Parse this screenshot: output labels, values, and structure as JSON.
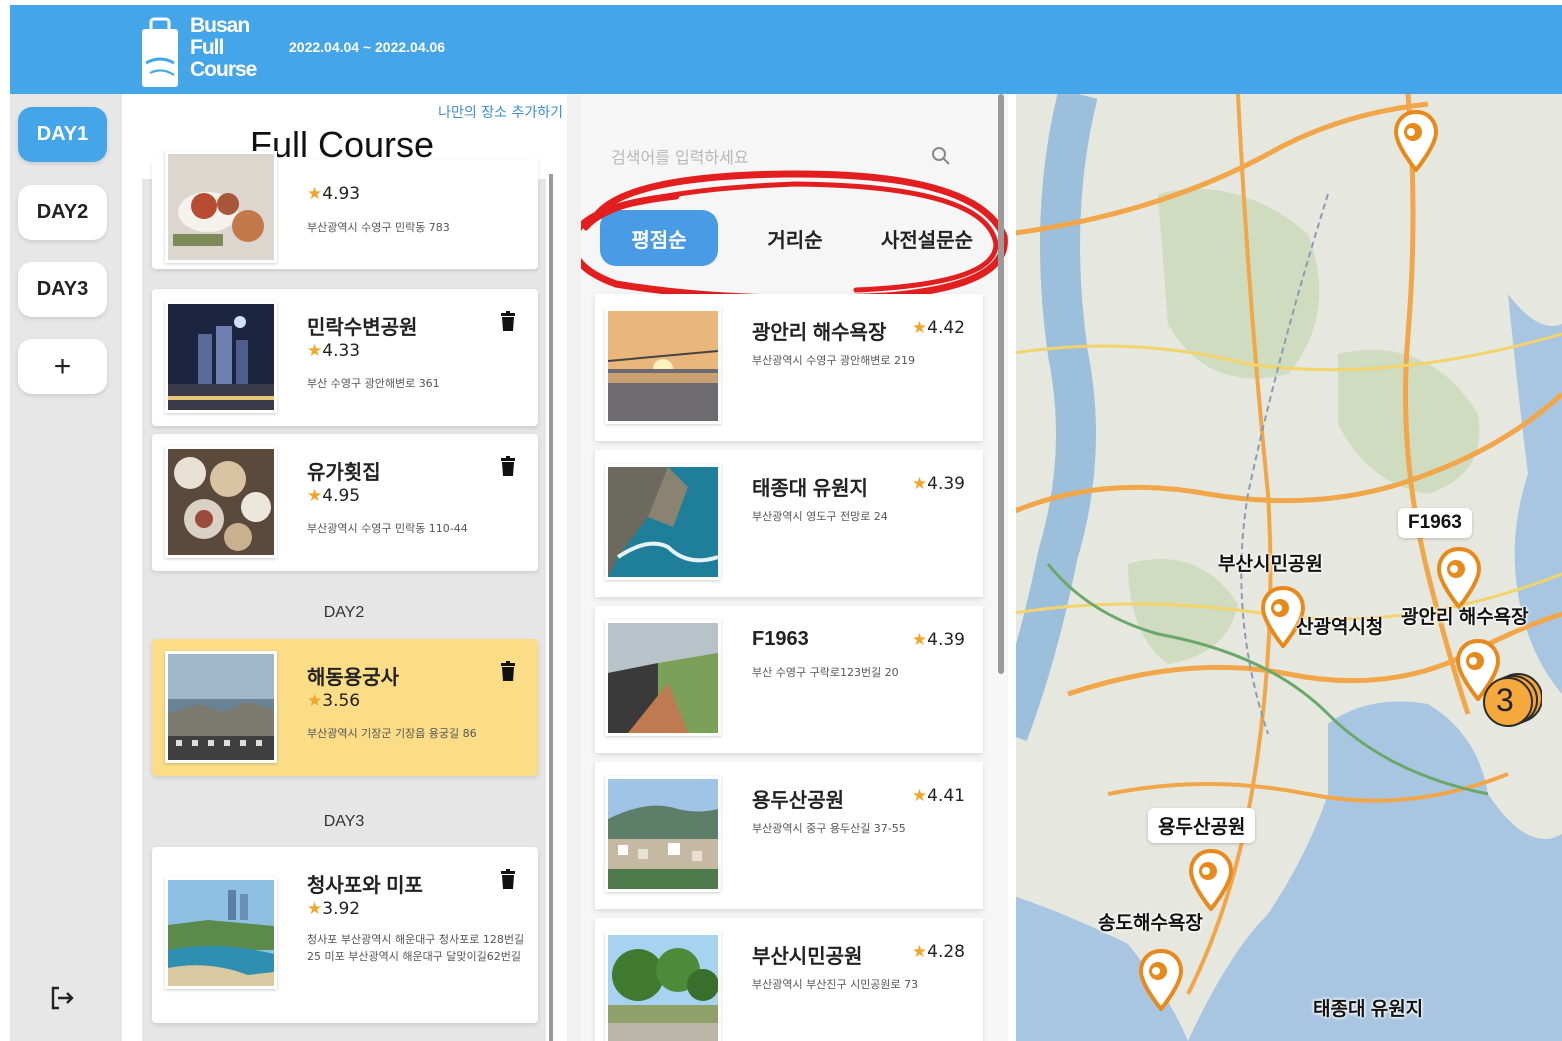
{
  "header": {
    "logo_lines": [
      "Busan",
      "Full",
      "Course"
    ],
    "dates": "2022.04.04 ~ 2022.04.06",
    "color": "#45a5e9"
  },
  "day_sidebar": {
    "days": [
      "DAY1",
      "DAY2",
      "DAY3"
    ],
    "active": "DAY1",
    "add_label": "+",
    "logout_icon": "logout-icon"
  },
  "course": {
    "add_place_link": "나만의 장소 추가하기",
    "title": "Full Course",
    "day_labels": [
      "DAY2",
      "DAY3"
    ],
    "items": [
      {
        "name": "",
        "rating": "4.93",
        "address": "부산광역시 수영구 민락동 783"
      },
      {
        "name": "민락수변공원",
        "rating": "4.33",
        "address": "부산 수영구 광안해변로 361"
      },
      {
        "name": "유가횟집",
        "rating": "4.95",
        "address": "부산광역시 수영구 민락동 110-44"
      },
      {
        "name": "해동용궁사",
        "rating": "3.56",
        "address": "부산광역시 기장군 기장읍 용궁길 86"
      },
      {
        "name": "청사포와 미포",
        "rating": "3.92",
        "address": "청사포 부산광역시 해운대구 청사포로 128번길 25 미포 부산광역시 해운대구 달맞이길62번길"
      }
    ]
  },
  "search": {
    "placeholder": "검색어를 입력하세요",
    "sort_tabs": [
      "평점순",
      "거리순",
      "사전설문순"
    ],
    "active_sort": "평점순",
    "results": [
      {
        "name": "광안리 해수욕장",
        "rating": "4.42",
        "address": "부산광역시 수영구 광안해변로 219"
      },
      {
        "name": "태종대 유원지",
        "rating": "4.39",
        "address": "부산광역시 영도구 전망로 24"
      },
      {
        "name": "F1963",
        "rating": "4.39",
        "address": "부산 수영구 구락로123번길 20"
      },
      {
        "name": "용두산공원",
        "rating": "4.41",
        "address": "부산광역시 중구 용두산길 37-55"
      },
      {
        "name": "부산시민공원",
        "rating": "4.28",
        "address": "부산광역시 부산진구 시민공원로 73"
      }
    ]
  },
  "map": {
    "labels": {
      "f1963": "F1963",
      "citizen_park": "부산시민공원",
      "city_hall": "산광역시청",
      "gwangalli": "광안리 해수욕장",
      "yongdusan": "용두산공원",
      "songdo": "송도해수욕장",
      "taejongdae": "태종대 유원지"
    },
    "cluster_count": "3",
    "pin_color": "#e8891c"
  }
}
